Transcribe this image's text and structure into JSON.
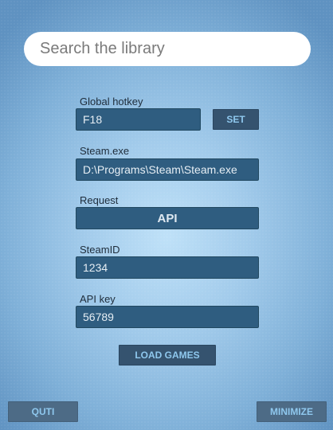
{
  "search": {
    "placeholder": "Search the library",
    "value": ""
  },
  "hotkey": {
    "label": "Global hotkey",
    "value": "F18",
    "set_button": "SET"
  },
  "steam_exe": {
    "label": "Steam.exe",
    "value": "D:\\Programs\\Steam\\Steam.exe"
  },
  "request": {
    "label": "Request",
    "value": "API"
  },
  "steam_id": {
    "label": "SteamID",
    "value": "1234"
  },
  "api_key": {
    "label": "API key",
    "value": "56789"
  },
  "load_games_button": "LOAD GAMES",
  "footer": {
    "quit_button": "QUTI",
    "minimize_button": "MINIMIZE"
  },
  "colors": {
    "field_background": "#2f5d80",
    "button_background": "#35536f",
    "button_text": "#8fc8ee"
  }
}
